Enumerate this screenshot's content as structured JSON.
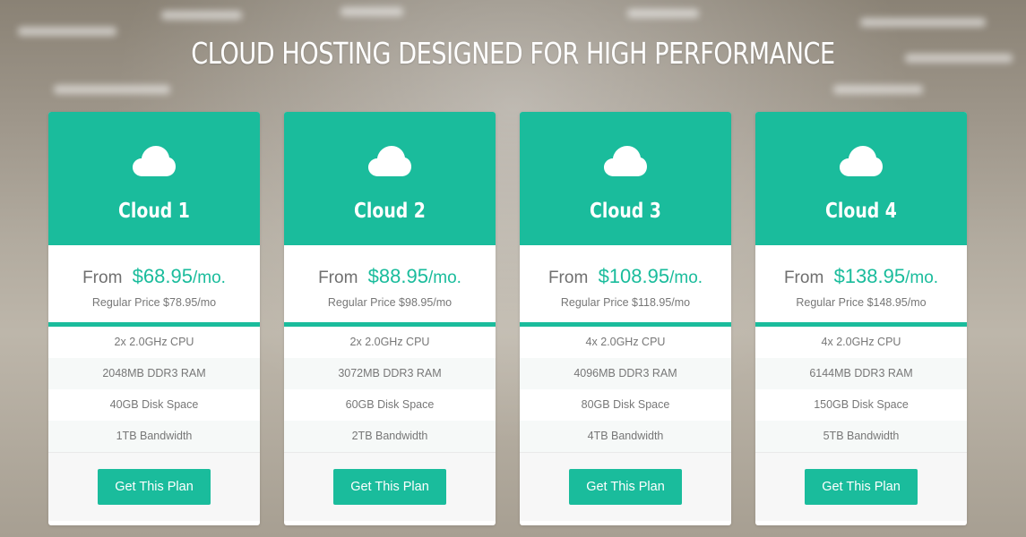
{
  "page": {
    "title": "CLOUD HOSTING DESIGNED FOR HIGH PERFORMANCE",
    "accent_color": "#1abc9c"
  },
  "plans": [
    {
      "icon": "cloud-icon",
      "name": "Cloud 1",
      "from_label": "From",
      "price": "$68.95",
      "period": "/mo.",
      "regular_price": "Regular Price $78.95/mo",
      "features": [
        "2x 2.0GHz CPU",
        "2048MB DDR3 RAM",
        "40GB Disk Space",
        "1TB Bandwidth"
      ],
      "button_label": "Get This Plan"
    },
    {
      "icon": "cloud-icon",
      "name": "Cloud 2",
      "from_label": "From",
      "price": "$88.95",
      "period": "/mo.",
      "regular_price": "Regular Price $98.95/mo",
      "features": [
        "2x 2.0GHz CPU",
        "3072MB DDR3 RAM",
        "60GB Disk Space",
        "2TB Bandwidth"
      ],
      "button_label": "Get This Plan"
    },
    {
      "icon": "cloud-icon",
      "name": "Cloud 3",
      "from_label": "From",
      "price": "$108.95",
      "period": "/mo.",
      "regular_price": "Regular Price $118.95/mo",
      "features": [
        "4x 2.0GHz CPU",
        "4096MB DDR3 RAM",
        "80GB Disk Space",
        "4TB Bandwidth"
      ],
      "button_label": "Get This Plan"
    },
    {
      "icon": "cloud-icon",
      "name": "Cloud 4",
      "from_label": "From",
      "price": "$138.95",
      "period": "/mo.",
      "regular_price": "Regular Price $148.95/mo",
      "features": [
        "4x 2.0GHz CPU",
        "6144MB DDR3 RAM",
        "150GB Disk Space",
        "5TB Bandwidth"
      ],
      "button_label": "Get This Plan"
    }
  ]
}
